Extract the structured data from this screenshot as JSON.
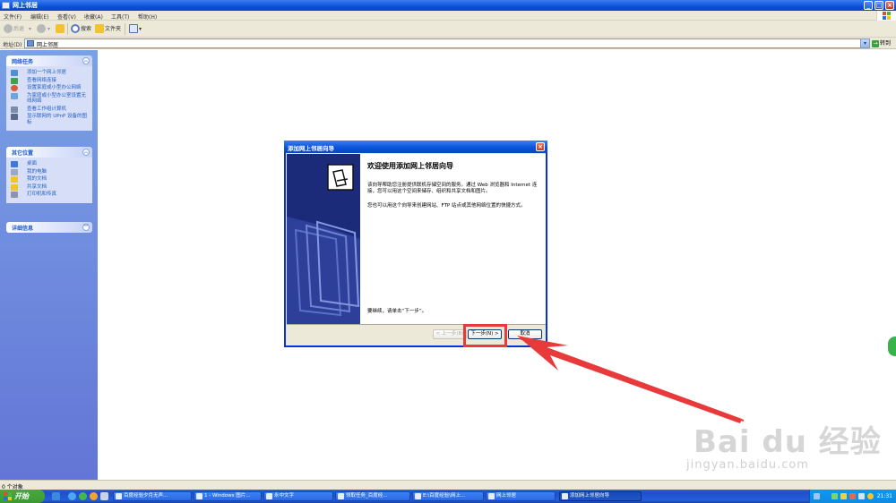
{
  "window": {
    "title": "网上邻居"
  },
  "menu": [
    "文件(F)",
    "编辑(E)",
    "查看(V)",
    "收藏(A)",
    "工具(T)",
    "帮助(H)"
  ],
  "toolbar": {
    "back": "后退",
    "search": "搜索",
    "folders": "文件夹"
  },
  "address": {
    "label": "地址(D)",
    "value": "网上邻居",
    "go": "转到"
  },
  "taskpane": {
    "network_tasks": {
      "title": "网络任务",
      "items": [
        "添加一个网上邻居",
        "查看网络连接",
        "设置家庭或小型办公网络",
        "为家庭或小型办公室设置无线网络",
        "查看工作组计算机",
        "显示联网的 UPnP 设备的图标"
      ]
    },
    "other_places": {
      "title": "其它位置",
      "items": [
        "桌面",
        "我的电脑",
        "我的文档",
        "共享文档",
        "打印机和传真"
      ]
    },
    "details": {
      "title": "详细信息"
    }
  },
  "wizard": {
    "title": "添加网上邻居向导",
    "heading": "欢迎使用添加网上邻居向导",
    "para1": "该向导帮助您注册提供联机存储空间的服务。通过 Web 浏览器和 Internet 连接，您可以用这个空间来储存、组织和共享文档和图片。",
    "para2": "您也可以用这个向导来创建网站、FTP 站点或其他网络位置的快捷方式。",
    "para3": "要继续，请单击“下一步”。",
    "back_btn": "< 上一步(B)",
    "next_btn": "下一步(N) >",
    "cancel_btn": "取消"
  },
  "status": {
    "text": "0 个对象"
  },
  "taskbar": {
    "start": "开始",
    "tasks": [
      "百度经验夕月无声...",
      "1 - Windows 图片...",
      "永中文字",
      "领取任务_百度经...",
      "E:\\百度经验\\网上...",
      "网上邻居",
      "添加网上邻居向导"
    ],
    "clock": "21:31"
  },
  "watermark": {
    "logo": "Bai du 经验",
    "url": "jingyan.baidu.com"
  },
  "colors": {
    "xp_blue": "#0a52d6",
    "taskpane_link": "#215dc6",
    "highlight_red": "#e83a3a",
    "start_green": "#3d9a33"
  }
}
